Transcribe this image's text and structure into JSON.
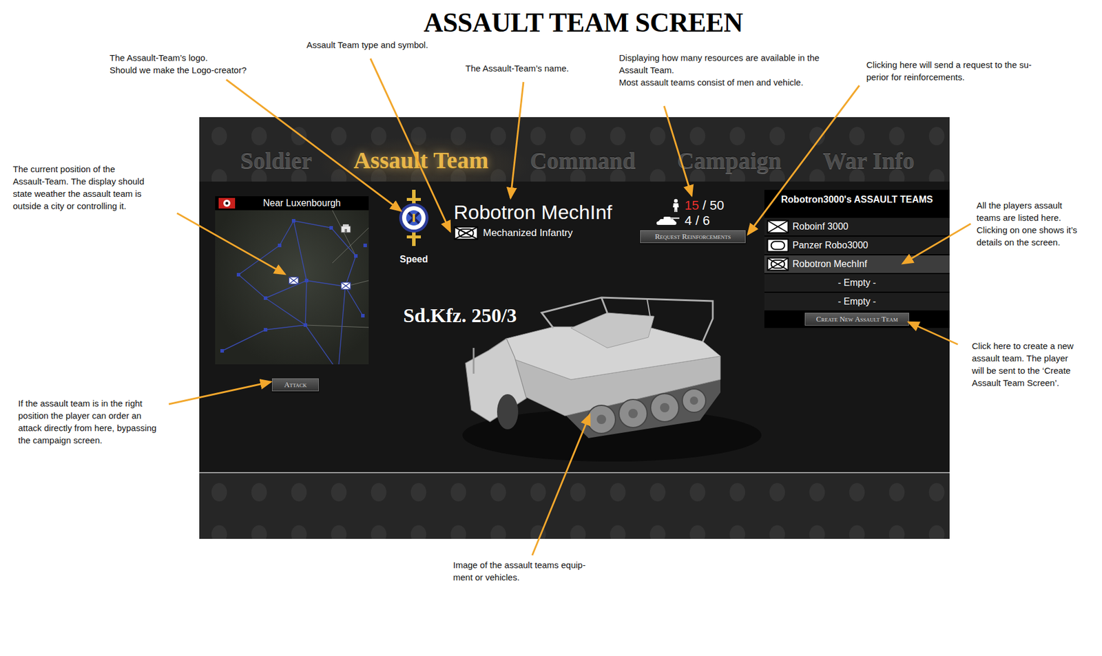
{
  "title": "ASSAULT TEAM SCREEN",
  "tabs": [
    {
      "label": "Soldier",
      "selected": false
    },
    {
      "label": "Assault Team",
      "selected": true
    },
    {
      "label": "Command",
      "selected": false
    },
    {
      "label": "Campaign",
      "selected": false
    },
    {
      "label": "War Info",
      "selected": false
    }
  ],
  "location": {
    "label": "Near Luxenbourgh"
  },
  "map": {
    "markers": [
      {
        "kind": "unit"
      },
      {
        "kind": "unit"
      },
      {
        "kind": "city"
      }
    ]
  },
  "attack_button": "Attack",
  "team": {
    "name": "Robotron MechInf",
    "type": "Mechanized Infantry",
    "type_kind": "mech-infantry",
    "logo_caption": "Speed"
  },
  "resources": {
    "divider": "/",
    "items": [
      {
        "kind": "men",
        "current": "15",
        "max": "50",
        "color": "#e8302c"
      },
      {
        "kind": "vehicles",
        "current": "4",
        "max": "6",
        "color": "#ffffff"
      }
    ],
    "button": "Request Reinforcements"
  },
  "vehicle": {
    "name": "Sd.Kfz. 250/3"
  },
  "teams_panel": {
    "title": "Robotron3000's ASSAULT TEAMS",
    "items": [
      {
        "label": "Roboinf 3000",
        "kind": "infantry",
        "selected": false
      },
      {
        "label": "Panzer Robo3000",
        "kind": "armor",
        "selected": false
      },
      {
        "label": "Robotron MechInf",
        "kind": "mech-infantry",
        "selected": true
      },
      {
        "label": "- Empty -",
        "kind": "empty",
        "selected": false
      },
      {
        "label": "- Empty -",
        "kind": "empty",
        "selected": false
      }
    ],
    "button": "Create New Assault Team"
  },
  "annotations": [
    {
      "lines": [
        "The Assault-Team’s logo.",
        "Should we make the Logo-creator?"
      ]
    },
    {
      "lines": [
        "Assault Team type and symbol."
      ]
    },
    {
      "lines": [
        "The Assault-Team’s name."
      ]
    },
    {
      "lines": [
        "Displaying how many resources are available in the",
        "Assault Team.",
        "Most assault teams consist of men and vehicle."
      ]
    },
    {
      "lines": [
        "Clicking here will send a request to the su-",
        "perior for reinforcements."
      ]
    },
    {
      "lines": [
        "The current position of the",
        "Assault-Team. The display should",
        "state weather the assault team is",
        "outside a city or controlling it."
      ]
    },
    {
      "lines": [
        "All the players assault",
        "teams are listed here.",
        "Clicking on one shows it’s",
        "details on the screen."
      ]
    },
    {
      "lines": [
        "Click here to create a new",
        "assault team. The player",
        "will be sent to the ‘Create",
        "Assault Team Screen’."
      ]
    },
    {
      "lines": [
        "If the assault team is in the right",
        "position the player can order an",
        "attack directly from here, bypassing",
        "the campaign screen."
      ]
    },
    {
      "lines": [
        "Image of the assault teams equip-",
        "ment or vehicles."
      ]
    }
  ]
}
